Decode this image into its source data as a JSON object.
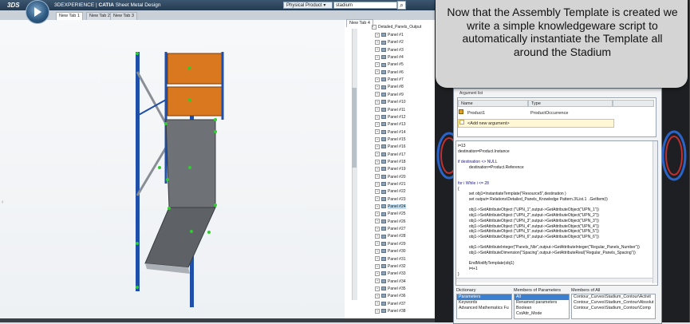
{
  "app": {
    "ds_logo": "3DS",
    "title_prefix": "3DEXPERIENCE | ",
    "title_brand": "CATIA",
    "title_suffix": " Sheet Metal Design"
  },
  "search": {
    "scope": "Physical Product ▾",
    "query": "stadium"
  },
  "tabs": [
    "New Tab 1",
    "New Tab 2",
    "New Tab 3"
  ],
  "tree_tabs": [
    "New Tab 4"
  ],
  "tree": {
    "header": "Detailed_Panels_Output",
    "items": [
      "Panel #1",
      "Panel #2",
      "Panel #3",
      "Panel #4",
      "Panel #5",
      "Panel #6",
      "Panel #7",
      "Panel #8",
      "Panel #9",
      "Panel #10",
      "Panel #11",
      "Panel #12",
      "Panel #13",
      "Panel #14",
      "Panel #15",
      "Panel #16",
      "Panel #17",
      "Panel #18",
      "Panel #19",
      "Panel #20",
      "Panel #21",
      "Panel #22",
      "Panel #23",
      "Panel #24",
      "Panel #25",
      "Panel #26",
      "Panel #27",
      "Panel #28",
      "Panel #29",
      "Panel #30",
      "Panel #31",
      "Panel #32",
      "Panel #33",
      "Panel #34",
      "Panel #35",
      "Panel #36",
      "Panel #37",
      "Panel #38"
    ],
    "selected_index": 23
  },
  "callout": {
    "text": "Now that the Assembly Template is created we write a simple knowledgeware script to automatically instantiate the Template all around the Stadium"
  },
  "dialog": {
    "argument_group": "Argument list",
    "columns": [
      "Name",
      "Type"
    ],
    "rows": [
      {
        "name": "Product1",
        "type": "ProductOccurrence"
      }
    ],
    "add_row": "<Add new argument>"
  },
  "script": {
    "lines": [
      "i=13",
      "destination=Product.Instance",
      "",
      "if destination <> NULL",
      "          destination=Product.Reference",
      "",
      "",
      "for i While i <= 28",
      "{",
      "          set obj1=InstantiateTemplate(\"Resource5\",destination )",
      "          set output= Relations\\Detailed_Panels_Knowledge Pattern.3\\List.1  .GetItem(i)",
      "",
      "          obj1->SetAttributeObject (\"UPN_1\",output->GetAttributeObject(\"UPN_1\"))",
      "          obj1->SetAttributeObject (\"UPN_2\",output->GetAttributeObject(\"UPN_2\"))",
      "          obj1->SetAttributeObject (\"UPN_3\",output->GetAttributeObject(\"UPN_3\"))",
      "          obj1->SetAttributeObject (\"UPN_4\",output->GetAttributeObject(\"UPN_4\"))",
      "          obj1->SetAttributeObject (\"UPN_5\",output->GetAttributeObject(\"UPN_5\"))",
      "          obj1->SetAttributeObject (\"UPN_6\",output->GetAttributeObject(\"UPN_6\"))",
      "",
      "          obj1->SetAttributeInteger(\"Panels_Nbr\",output->GetAttributeInteger(\"Regular_Panels_Number\"))",
      "          obj1->SetAttributeDimension(\"Spacing\",output->GetAttributeReal(\"Regular_Panels_Spacing\"))",
      "",
      "          EndModifyTemplate(obj1)",
      "          i=i+1",
      "}"
    ]
  },
  "bottom_panels": {
    "dictionary": {
      "title": "Dictionary",
      "items": [
        "Parameters",
        "Keywords",
        "Advanced Mathematics Fu"
      ],
      "selected_index": 0
    },
    "members_of_parameters": {
      "title": "Members of Parameters",
      "items": [
        "All",
        "Renamed parameters",
        "Boolean",
        "CstAttr_Mode"
      ],
      "selected_index": 0
    },
    "members_of_all": {
      "title": "Members of All",
      "items": [
        "Contour_Curves\\Stadium_Contour\\Activit",
        "Contour_Curves\\Stadium_Contour\\Absolut",
        "Contour_Curves\\Stadium_Contour\\Comp"
      ]
    }
  },
  "colors": {
    "orange_panel": "#d9781e",
    "frame_blue": "#1f4fa8",
    "sheet_gray": "#6e7276",
    "point_green": "#2dcf2d",
    "callout_bg": "#d4d4d4"
  }
}
